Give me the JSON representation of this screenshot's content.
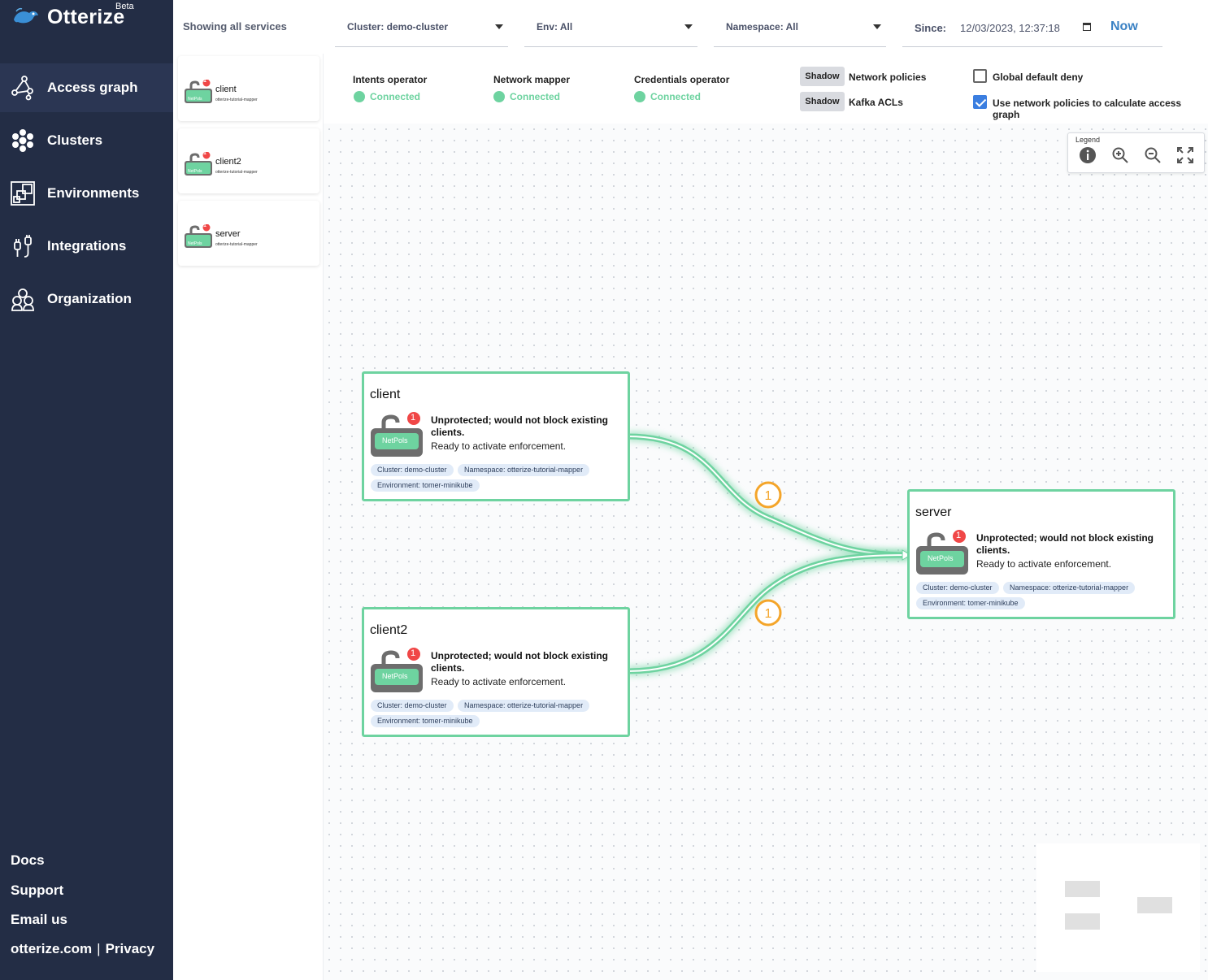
{
  "app": {
    "name": "Otterize",
    "badge": "Beta"
  },
  "nav": {
    "items": [
      {
        "label": "Access graph",
        "icon": "graph-icon"
      },
      {
        "label": "Clusters",
        "icon": "clusters-icon"
      },
      {
        "label": "Environments",
        "icon": "environments-icon"
      },
      {
        "label": "Integrations",
        "icon": "integrations-icon"
      },
      {
        "label": "Organization",
        "icon": "organization-icon"
      }
    ],
    "bottom": {
      "docs": "Docs",
      "support": "Support",
      "email": "Email us",
      "site": "otterize.com",
      "sep": "|",
      "privacy": "Privacy"
    }
  },
  "filters": {
    "showing": "Showing all services",
    "cluster": "Cluster: demo-cluster",
    "env": "Env: All",
    "namespace": "Namespace: All",
    "since_label": "Since:",
    "since_value": "12/03/2023, 12:37:18",
    "now": "Now"
  },
  "services": [
    {
      "name": "client",
      "namespace": "otterize-tutorial-mapper",
      "badge": "1",
      "lock_label": "NetPols"
    },
    {
      "name": "client2",
      "namespace": "otterize-tutorial-mapper",
      "badge": "1",
      "lock_label": "NetPols"
    },
    {
      "name": "server",
      "namespace": "otterize-tutorial-mapper",
      "badge": "1",
      "lock_label": "NetPols"
    }
  ],
  "status": {
    "intents": {
      "label": "Intents operator",
      "status": "Connected"
    },
    "mapper": {
      "label": "Network mapper",
      "status": "Connected"
    },
    "credentials": {
      "label": "Credentials operator",
      "status": "Connected"
    },
    "netpol": {
      "button": "Shadow",
      "label": "Network policies"
    },
    "kafka": {
      "button": "Shadow",
      "label": "Kafka ACLs"
    },
    "global_deny": {
      "label": "Global default deny",
      "checked": false
    },
    "use_netpol": {
      "label": "Use network policies to calculate access graph",
      "checked": true
    },
    "colors": {
      "connected": "#6ed3a0",
      "accent": "#3b82c4"
    }
  },
  "toolbox": {
    "legend": "Legend"
  },
  "graph": {
    "nodes": [
      {
        "name": "client",
        "badge": "1",
        "lock_label": "NetPols",
        "msg": "Unprotected; would not block existing clients.",
        "sub": "Ready to activate enforcement.",
        "cluster": "Cluster: demo-cluster",
        "namespace": "Namespace: otterize-tutorial-mapper",
        "environment": "Environment: tomer-minikube"
      },
      {
        "name": "client2",
        "badge": "1",
        "lock_label": "NetPols",
        "msg": "Unprotected; would not block existing clients.",
        "sub": "Ready to activate enforcement.",
        "cluster": "Cluster: demo-cluster",
        "namespace": "Namespace: otterize-tutorial-mapper",
        "environment": "Environment: tomer-minikube"
      },
      {
        "name": "server",
        "badge": "1",
        "lock_label": "NetPols",
        "msg": "Unprotected; would not block existing clients.",
        "sub": "Ready to activate enforcement.",
        "cluster": "Cluster: demo-cluster",
        "namespace": "Namespace: otterize-tutorial-mapper",
        "environment": "Environment: tomer-minikube"
      }
    ],
    "edges": [
      {
        "from": "client",
        "to": "server",
        "count": "1"
      },
      {
        "from": "client2",
        "to": "server",
        "count": "1"
      }
    ],
    "edge_color": "#6ed3a0",
    "count_color": "#f4a52a"
  }
}
